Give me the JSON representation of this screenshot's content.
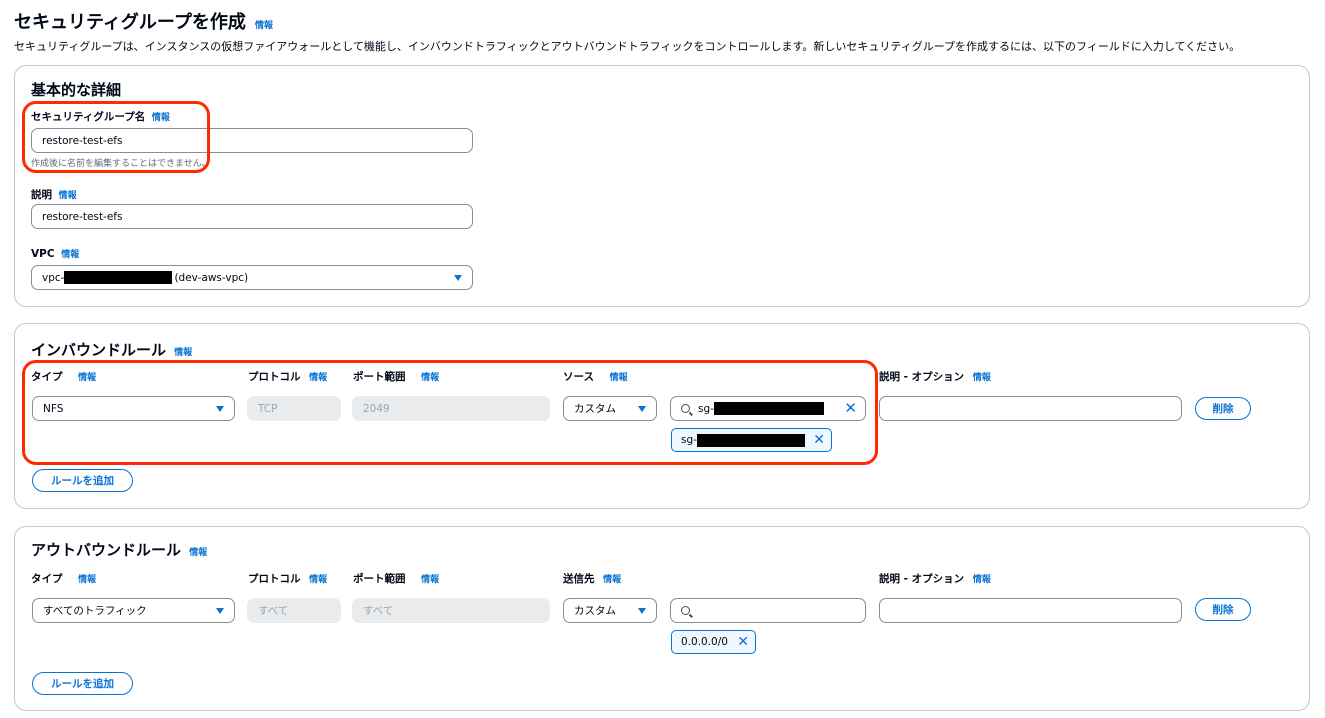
{
  "page": {
    "title": "セキュリティグループを作成",
    "info": "情報",
    "description": "セキュリティグループは、インスタンスの仮想ファイアウォールとして機能し、インバウンドトラフィックとアウトバウンドトラフィックをコントロールします。新しいセキュリティグループを作成するには、以下のフィールドに入力してください。"
  },
  "basic": {
    "title": "基本的な詳細",
    "name_label": "セキュリティグループ名",
    "name_value": "restore-test-efs",
    "name_hint": "作成後に名前を編集することはできません。",
    "desc_label": "説明",
    "desc_value": "restore-test-efs",
    "vpc_label": "VPC",
    "vpc_prefix": "vpc-",
    "vpc_suffix": "(dev-aws-vpc)"
  },
  "inbound": {
    "title": "インバウンドルール",
    "col_type": "タイプ",
    "col_protocol": "プロトコル",
    "col_port": "ポート範囲",
    "col_source": "ソース",
    "col_desc": "説明 - オプション",
    "type_value": "NFS",
    "protocol_value": "TCP",
    "port_value": "2049",
    "source_value": "カスタム",
    "search_prefix": "sg-",
    "token_prefix": "sg-",
    "delete_label": "削除",
    "add_rule_label": "ルールを追加"
  },
  "outbound": {
    "title": "アウトバウンドルール",
    "col_type": "タイプ",
    "col_protocol": "プロトコル",
    "col_port": "ポート範囲",
    "col_dest": "送信先",
    "col_desc": "説明 - オプション",
    "type_value": "すべてのトラフィック",
    "protocol_value": "すべて",
    "port_value": "すべて",
    "dest_value": "カスタム",
    "token_value": "0.0.0.0/0",
    "delete_label": "削除",
    "add_rule_label": "ルールを追加"
  },
  "colors": {
    "accent": "#0972d3",
    "highlight": "#ff2a00",
    "border": "#c6c6cd"
  }
}
